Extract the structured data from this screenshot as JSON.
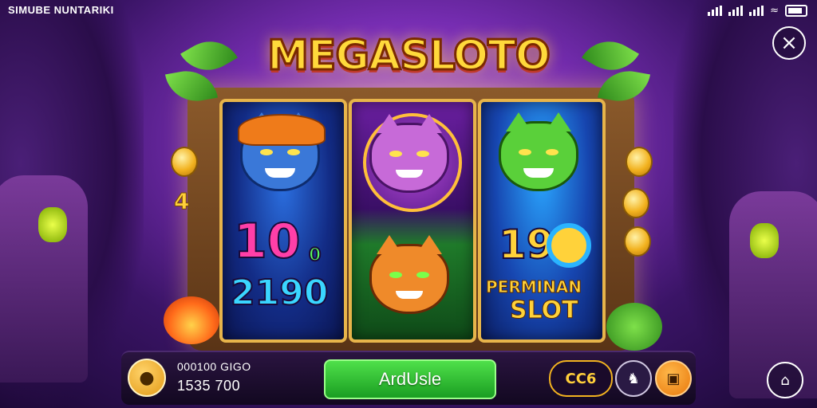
{
  "status_bar": {
    "carrier": "SIMUBE NUNTARIKI"
  },
  "logo": {
    "text": "MEGASLOTO"
  },
  "reels": [
    {
      "top_symbol": "hat-cat-icon",
      "bottom_text_1": "10",
      "bottom_text_small": "0",
      "bottom_text_2": "2190"
    },
    {
      "top_symbol": "purple-cat-icon",
      "bottom_symbol": "orange-cat-icon"
    },
    {
      "top_symbol": "green-cat-icon",
      "number_text": "19",
      "label_line1": "PERMINAN",
      "label_line2": "SLOT"
    }
  ],
  "side_number": "4",
  "bottom_bar": {
    "balance_label": "000100 GIGO",
    "balance_value": "1535 700",
    "spin_label": "ArdUsle",
    "auto_label": "CC6"
  },
  "colors": {
    "accent_gold": "#f2b21f",
    "spin_green": "#2fbf2f",
    "bg_purple": "#7b2fb8"
  }
}
